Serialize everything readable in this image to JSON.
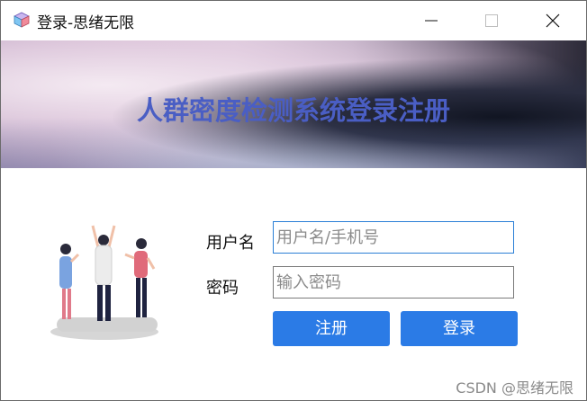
{
  "window": {
    "title": "登录-思绪无限",
    "controls": [
      "minimize-icon",
      "maximize-icon",
      "close-icon"
    ]
  },
  "banner": {
    "title": "人群密度检测系统登录注册"
  },
  "form": {
    "username_label": "用户名",
    "username_placeholder": "用户名/手机号",
    "password_label": "密码",
    "password_placeholder": "输入密码",
    "register_label": "注册",
    "login_label": "登录"
  },
  "watermark": "CSDN @思绪无限",
  "colors": {
    "accent": "#2b7be6",
    "banner_title": "#4a5ec4"
  }
}
